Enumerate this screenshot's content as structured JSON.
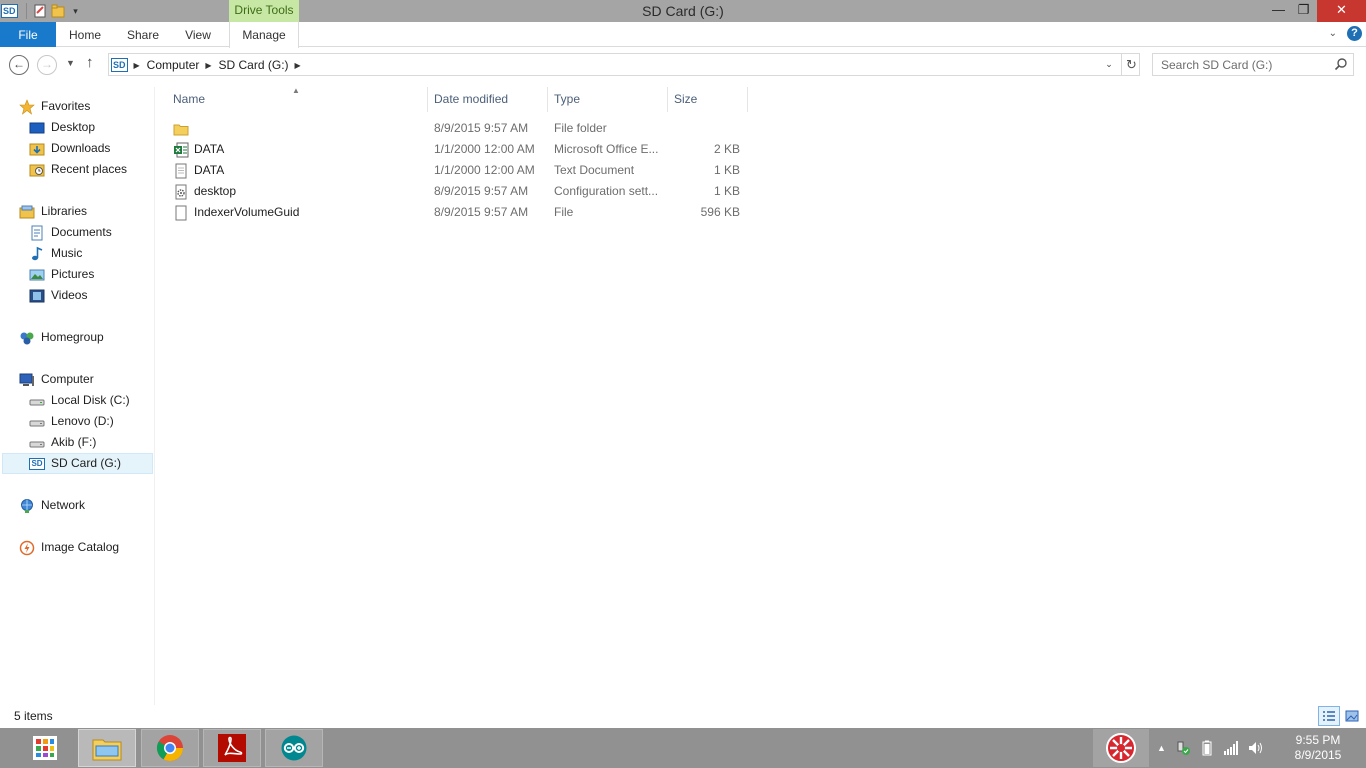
{
  "window": {
    "title": "SD Card (G:)",
    "contextual_tab_group": "Drive Tools",
    "drive_logo_text": "SD",
    "close_glyph": "✕",
    "maximize_glyph": "❐",
    "minimize_glyph": "—"
  },
  "ribbon": {
    "tabs": [
      {
        "label": "File"
      },
      {
        "label": "Home"
      },
      {
        "label": "Share"
      },
      {
        "label": "View"
      },
      {
        "label": "Manage"
      }
    ],
    "help": "?"
  },
  "address_bar": {
    "breadcrumbs": [
      "Computer",
      "SD Card (G:)"
    ],
    "search_placeholder": "Search SD Card (G:)"
  },
  "nav_pane": {
    "favorites": {
      "label": "Favorites",
      "items": [
        "Desktop",
        "Downloads",
        "Recent places"
      ]
    },
    "libraries": {
      "label": "Libraries",
      "items": [
        "Documents",
        "Music",
        "Pictures",
        "Videos"
      ]
    },
    "homegroup": {
      "label": "Homegroup"
    },
    "computer": {
      "label": "Computer",
      "items": [
        "Local Disk (C:)",
        "Lenovo (D:)",
        "Akib (F:)",
        "SD Card (G:)"
      ]
    },
    "network": {
      "label": "Network"
    },
    "image_catalog": {
      "label": "Image Catalog"
    },
    "selected": "SD Card (G:)"
  },
  "file_list": {
    "columns": [
      "Name",
      "Date modified",
      "Type",
      "Size"
    ],
    "sorted_by": "Name",
    "rows": [
      {
        "name": "",
        "date": "8/9/2015 9:57 AM",
        "type": "File folder",
        "size": "",
        "icon": "folder-icon"
      },
      {
        "name": "DATA",
        "date": "1/1/2000 12:00 AM",
        "type": "Microsoft Office E...",
        "size": "2 KB",
        "icon": "excel-file-icon"
      },
      {
        "name": "DATA",
        "date": "1/1/2000 12:00 AM",
        "type": "Text Document",
        "size": "1 KB",
        "icon": "text-file-icon"
      },
      {
        "name": "desktop",
        "date": "8/9/2015 9:57 AM",
        "type": "Configuration sett...",
        "size": "1 KB",
        "icon": "config-file-icon"
      },
      {
        "name": "IndexerVolumeGuid",
        "date": "8/9/2015 9:57 AM",
        "type": "File",
        "size": "596 KB",
        "icon": "generic-file-icon"
      }
    ]
  },
  "status_bar": {
    "item_count": "5 items",
    "view": "details"
  },
  "taskbar": {
    "pinned": [
      "start-icon",
      "file-explorer-icon",
      "chrome-icon",
      "acrobat-icon",
      "arduino-icon"
    ],
    "clock_time": "9:55 PM",
    "clock_date": "8/9/2015"
  },
  "colors": {
    "file_tab": "#1979ca",
    "drive_tools": "#c7e8a5",
    "close_button": "#c7372f",
    "title_bar": "#a5a5a5",
    "taskbar": "#919191",
    "column_header_text": "#4c607a"
  }
}
